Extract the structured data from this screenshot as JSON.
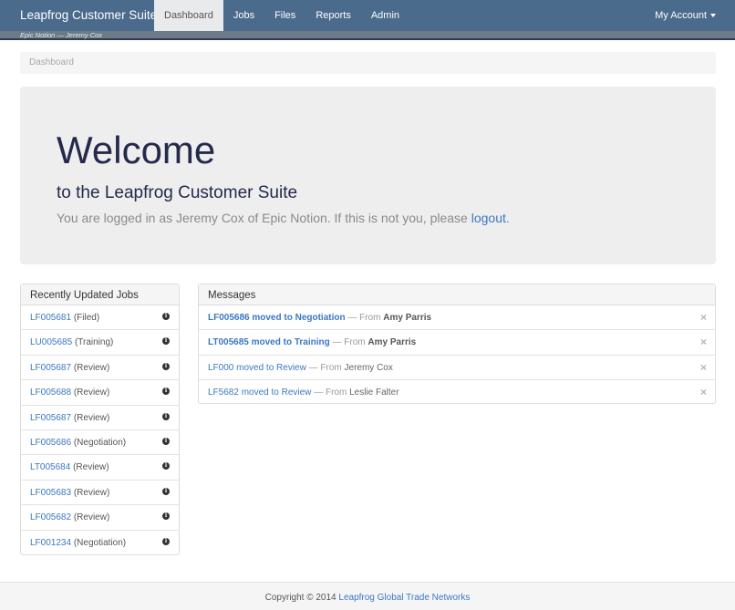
{
  "navbar": {
    "brand": "Leapfrog Customer Suite",
    "items": [
      "Dashboard",
      "Jobs",
      "Files",
      "Reports",
      "Admin"
    ],
    "active": "Dashboard",
    "account_label": "My Account"
  },
  "subbar": {
    "text": "Epic Notion — Jeremy Cox"
  },
  "breadcrumb": {
    "label": "Dashboard"
  },
  "jumbotron": {
    "title": "Welcome",
    "subtitle": "to the Leapfrog Customer Suite",
    "lead_text": "You are logged in as Jeremy Cox of Epic Notion. If this is not you, please",
    "logout_label": "logout",
    "lead_end": "."
  },
  "jobs_panel": {
    "heading": "Recently Updated Jobs",
    "items": [
      {
        "id": "LF005681",
        "status": "(Filed)"
      },
      {
        "id": "LU005685",
        "status": "(Training)"
      },
      {
        "id": "LF005687",
        "status": "(Review)"
      },
      {
        "id": "LF005688",
        "status": "(Review)"
      },
      {
        "id": "LF005687",
        "status": "(Review)"
      },
      {
        "id": "LF005686",
        "status": "(Negotiation)"
      },
      {
        "id": "LT005684",
        "status": "(Review)"
      },
      {
        "id": "LF005683",
        "status": "(Review)"
      },
      {
        "id": "LF005682",
        "status": "(Review)"
      },
      {
        "id": "LF001234",
        "status": "(Negotiation)"
      }
    ],
    "icon": "info-icon"
  },
  "messages_panel": {
    "heading": "Messages",
    "items": [
      {
        "subject": "LF005686 moved to Negotiation",
        "from_label": "— From",
        "sender": "Amy Parris",
        "unread": true
      },
      {
        "subject": "LT005685 moved to Training",
        "from_label": "— From",
        "sender": "Amy Parris",
        "unread": true
      },
      {
        "subject": "LF000 moved to Review",
        "from_label": "— From",
        "sender": "Jeremy Cox",
        "unread": false
      },
      {
        "subject": "LF5682 moved to Review",
        "from_label": "— From",
        "sender": "Leslie Falter",
        "unread": false
      }
    ],
    "dismiss_glyph": "×"
  },
  "footer": {
    "text": "Copyright © 2014",
    "link_label": "Leapfrog Global Trade Networks"
  },
  "colors": {
    "navbar": "#4a6b8b",
    "link": "#3c78c3",
    "title": "#252a4c"
  }
}
